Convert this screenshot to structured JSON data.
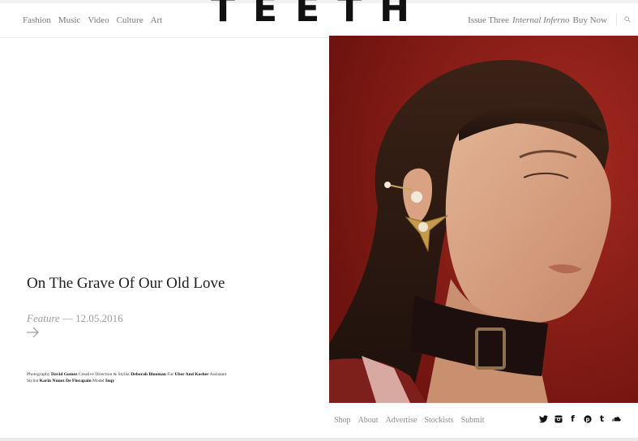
{
  "header": {
    "nav": [
      "Fashion",
      "Music",
      "Video",
      "Culture",
      "Art"
    ],
    "logo": "TEETH",
    "issue_label": "Issue Three",
    "issue_title": "Internal Inferno",
    "buy_label": "Buy Now"
  },
  "article": {
    "title": "On The Grave Of Our Old Love",
    "category": "Feature",
    "date_sep": " — ",
    "date": "12.05.2016",
    "credits": [
      {
        "role": "Photography",
        "name": "David Gomez"
      },
      {
        "role": "Creative Direction & Stylist",
        "name": "Deborah Blooman"
      },
      {
        "role": "Fur",
        "name": "Uber And Kosher"
      },
      {
        "role": "Assistant Stylist",
        "name": "Karin Nunez De Florapain"
      },
      {
        "role": "Model",
        "name": "Inqy"
      }
    ]
  },
  "footer": {
    "links": [
      "Shop",
      "About",
      "Advertise",
      "Stockists",
      "Submit"
    ],
    "social_icons": [
      "twitter-icon",
      "instagram-icon",
      "facebook-icon",
      "pinterest-icon",
      "tumblr-icon",
      "soundcloud-icon"
    ]
  },
  "colors": {
    "photo_background": "#8e1c16",
    "text_grey": "#7a7a7a"
  }
}
